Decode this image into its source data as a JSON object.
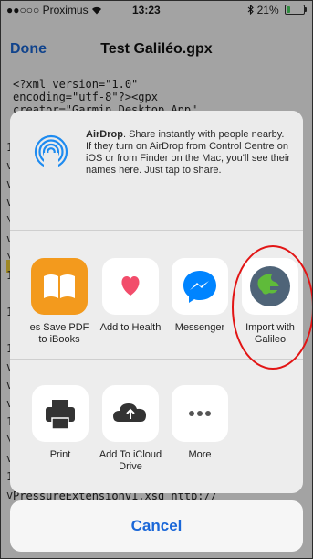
{
  "status_bar": {
    "carrier": "●●○○○ Proximus",
    "time": "13:23",
    "battery_pct": "21%",
    "battery_level": 0.21
  },
  "nav": {
    "done_label": "Done",
    "title": "Test Galiléo.gpx"
  },
  "background_code": {
    "top_lines": "<?xml version=\"1.0\"\nencoding=\"utf-8\"?><gpx\ncreator=\"Garmin Desktop App\"",
    "bottom_line": "PressureExtensionv1.xsd http://",
    "left_edge_chars": [
      "1",
      "v",
      "v",
      "v",
      "\\",
      "v",
      "\\",
      "1",
      "",
      "1",
      "",
      "1",
      "v",
      "v",
      "v",
      "1",
      "\\",
      "v",
      "1",
      "v"
    ]
  },
  "airdrop": {
    "title": "AirDrop",
    "text": ". Share instantly with people nearby. If they turn on AirDrop from Control Centre on iOS or from Finder on the Mac, you'll see their names here. Just tap to share."
  },
  "apps": [
    {
      "label": "es Save PDF to iBooks",
      "icon": "ibooks-icon"
    },
    {
      "label": "Add to Health",
      "icon": "health-icon"
    },
    {
      "label": "Messenger",
      "icon": "messenger-icon"
    },
    {
      "label": "Import with Galileo",
      "icon": "galileo-icon"
    }
  ],
  "actions": [
    {
      "label": "Print",
      "icon": "printer-icon"
    },
    {
      "label": "Add To iCloud Drive",
      "icon": "icloud-upload-icon"
    },
    {
      "label": "More",
      "icon": "more-dots-icon"
    }
  ],
  "cancel_label": "Cancel",
  "colors": {
    "accent": "#1a67d8",
    "highlight": "#e21515",
    "health": "#f24d6b",
    "messenger": "#0084ff",
    "ibooks": "#f39a1d"
  }
}
